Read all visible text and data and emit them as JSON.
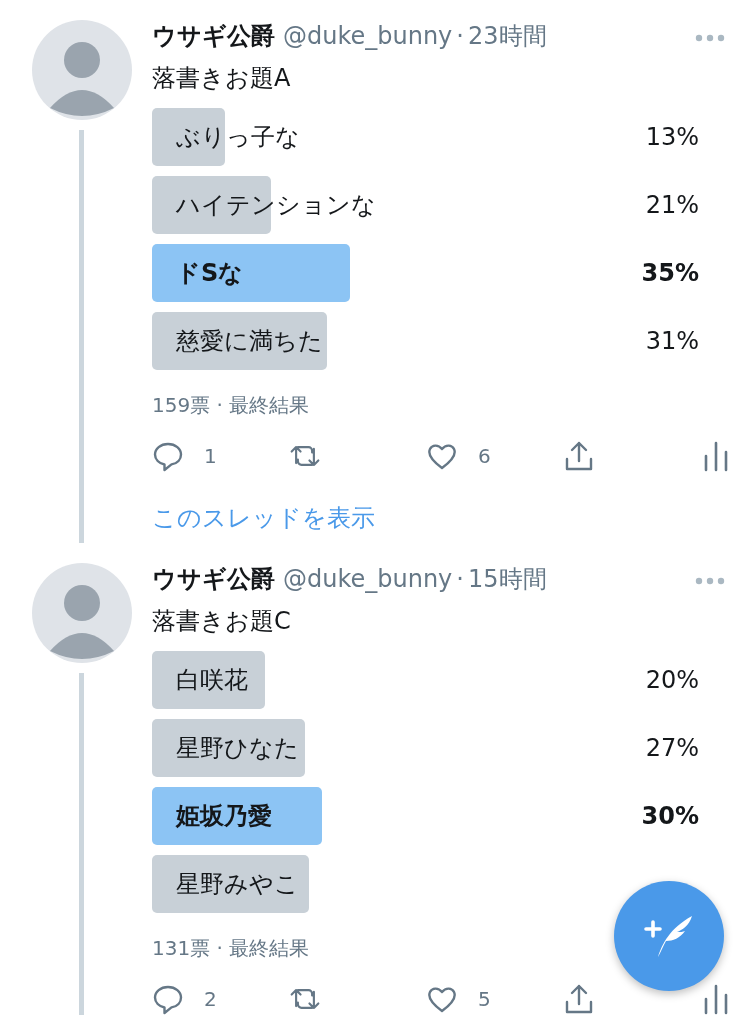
{
  "tweets": [
    {
      "name": "ウサギ公爵",
      "handle": "@duke_bunny",
      "separator": "·",
      "time": "23時間",
      "text": "落書きお題A",
      "options": [
        {
          "label": "ぶりっ子な",
          "percent": "13%",
          "selected": false
        },
        {
          "label": "ハイテンションな",
          "percent": "21%",
          "selected": false
        },
        {
          "label": "ドSな",
          "percent": "35%",
          "selected": true
        },
        {
          "label": "慈愛に満ちた",
          "percent": "31%",
          "selected": false
        }
      ],
      "votes": "159票 · 最終結果",
      "replies": "1",
      "likes": "6",
      "thread_link": "このスレッドを表示"
    },
    {
      "name": "ウサギ公爵",
      "handle": "@duke_bunny",
      "separator": "·",
      "time": "15時間",
      "text": "落書きお題C",
      "options": [
        {
          "label": "白咲花",
          "percent": "20%",
          "selected": false
        },
        {
          "label": "星野ひなた",
          "percent": "27%",
          "selected": false
        },
        {
          "label": "姫坂乃愛",
          "percent": "30%",
          "selected": true
        },
        {
          "label": "星野みやこ",
          "selected": false
        }
      ],
      "votes": "131票 · 最終結果",
      "replies": "2",
      "likes": "5"
    }
  ]
}
